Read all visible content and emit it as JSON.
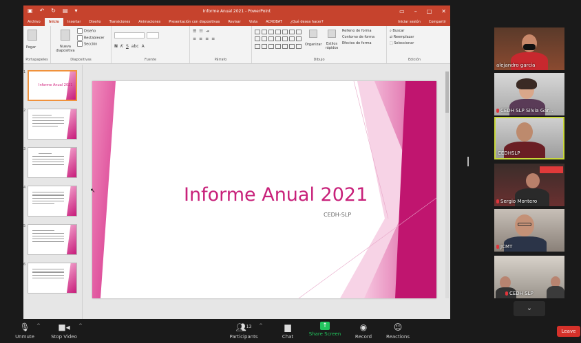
{
  "powerpoint": {
    "window_title": "Informe Anual 2021 - PowerPoint",
    "tabs": [
      "Archivo",
      "Inicio",
      "Insertar",
      "Diseño",
      "Transiciones",
      "Animaciones",
      "Presentación con diapositivas",
      "Revisar",
      "Vista",
      "ACROBAT",
      "¿Qué desea hacer?"
    ],
    "tab_signin": "Iniciar sesión",
    "tab_share": "Compartir",
    "ribbon_groups": [
      "Portapapeles",
      "Diapositivas",
      "Fuente",
      "Párrafo",
      "Dibujo",
      "Edición"
    ],
    "ribbon_items": {
      "paste": "Pegar",
      "new_slide": "Nueva diapositiva",
      "layout": "Diseño",
      "reset": "Restablecer",
      "section": "Sección",
      "arrange": "Organizar",
      "quick_styles": "Estilos rápidos",
      "shape_fill": "Relleno de forma",
      "shape_outline": "Contorno de forma",
      "shape_effects": "Efectos de forma",
      "find": "Buscar",
      "replace": "Reemplazar",
      "select": "Seleccionar"
    },
    "slide": {
      "title": "Informe Anual 2021",
      "subtitle": "CEDH-SLP"
    },
    "thumbnails": [
      {
        "number": "1",
        "title": "Informe Anual 2021"
      },
      {
        "number": "2"
      },
      {
        "number": "3"
      },
      {
        "number": "4"
      },
      {
        "number": "5"
      },
      {
        "number": "6"
      }
    ],
    "colors": {
      "ribbon_red": "#c6432d",
      "slide_pink": "#c8217a"
    }
  },
  "participants_tiles": [
    {
      "name": "alejandro garcia"
    },
    {
      "name": "CEDH SLP Silvia Gar..."
    },
    {
      "name": "CEDHSLP"
    },
    {
      "name": "Sergio Montero"
    },
    {
      "name": "JCMT"
    },
    {
      "name": "CEDH SLP"
    }
  ],
  "toolbar": {
    "unmute": "Unmute",
    "stop_video": "Stop Video",
    "participants": "Participants",
    "participants_count": "13",
    "chat": "Chat",
    "share_screen": "Share Screen",
    "record": "Record",
    "reactions": "Reactions",
    "leave": "Leave"
  }
}
